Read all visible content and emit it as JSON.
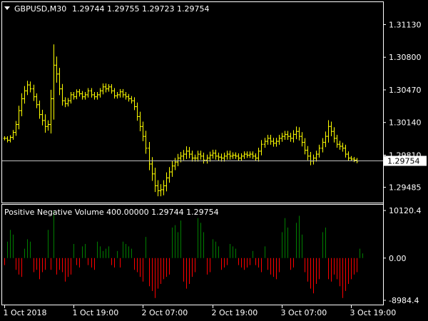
{
  "price_panel": {
    "symbol_label": "GBPUSD,M30",
    "ohlc": [
      "1.29744",
      "1.29755",
      "1.29723",
      "1.29754"
    ],
    "current_price_label": "1.29754",
    "bar_color": "#ffff00",
    "price_line_color": "#c0c0c0"
  },
  "indicator_panel": {
    "title": "Positive Negative Volume 400.00000 1.29744 1.29754",
    "positive_color": "#008000",
    "negative_color": "#ff0000"
  },
  "colors": {
    "background": "#000000",
    "frame": "#ffffff",
    "text": "#ffffff"
  },
  "chart_data": [
    {
      "type": "ohlc",
      "title": "GBPUSD,M30",
      "ylim": [
        1.2933,
        1.3135
      ],
      "y_ticks": [
        "1.31130",
        "1.30800",
        "1.30470",
        "1.30140",
        "1.29810",
        "1.29485"
      ],
      "y_tick_values": [
        1.3113,
        1.308,
        1.3047,
        1.3014,
        1.2981,
        1.29485
      ],
      "x_ticks": [
        "1 Oct 2018",
        "1 Oct 19:00",
        "2 Oct 07:00",
        "2 Oct 19:00",
        "3 Oct 07:00",
        "3 Oct 19:00"
      ],
      "x_tick_bar_index": [
        0,
        24,
        48,
        72,
        96,
        120
      ],
      "close": [
        1.2998,
        1.2996,
        1.2999,
        1.3004,
        1.3012,
        1.3026,
        1.3038,
        1.3046,
        1.3052,
        1.3048,
        1.304,
        1.3032,
        1.3022,
        1.3016,
        1.301,
        1.3012,
        1.3038,
        1.3072,
        1.3063,
        1.3048,
        1.3036,
        1.3033,
        1.3036,
        1.3042,
        1.304,
        1.3045,
        1.3043,
        1.304,
        1.3042,
        1.3046,
        1.3042,
        1.304,
        1.3042,
        1.3046,
        1.305,
        1.3048,
        1.305,
        1.3046,
        1.3041,
        1.3042,
        1.3045,
        1.3042,
        1.304,
        1.3038,
        1.3036,
        1.303,
        1.302,
        1.301,
        1.3,
        1.2988,
        1.2972,
        1.2962,
        1.295,
        1.2945,
        1.2946,
        1.295,
        1.2958,
        1.2964,
        1.297,
        1.2974,
        1.2978,
        1.298,
        1.2982,
        1.2985,
        1.2982,
        1.2978,
        1.2978,
        1.2982,
        1.298,
        1.2976,
        1.2978,
        1.2981,
        1.2983,
        1.298,
        1.2979,
        1.2978,
        1.298,
        1.2982,
        1.298,
        1.2981,
        1.298,
        1.2978,
        1.298,
        1.2982,
        1.2981,
        1.2982,
        1.298,
        1.2978,
        1.2985,
        1.2992,
        1.2995,
        1.2998,
        1.2995,
        1.2993,
        1.2995,
        1.2998,
        1.3,
        1.3002,
        1.3,
        1.2998,
        1.3002,
        1.3005,
        1.3,
        1.2994,
        1.2986,
        1.298,
        1.2975,
        1.2978,
        1.2982,
        1.2988,
        1.2994,
        1.3,
        1.301,
        1.3005,
        1.2998,
        1.2992,
        1.299,
        1.2988,
        1.2982,
        1.2978,
        1.2977,
        1.2976,
        1.2975
      ],
      "range": [
        0.0006,
        0.0006,
        0.0006,
        0.0007,
        0.001,
        0.0014,
        0.0016,
        0.0014,
        0.0012,
        0.001,
        0.0012,
        0.001,
        0.0012,
        0.0014,
        0.0018,
        0.0012,
        0.0026,
        0.006,
        0.0025,
        0.0018,
        0.0014,
        0.001,
        0.0008,
        0.0008,
        0.0008,
        0.0007,
        0.0008,
        0.0008,
        0.0008,
        0.0008,
        0.0008,
        0.0008,
        0.0008,
        0.0008,
        0.001,
        0.001,
        0.0008,
        0.0008,
        0.0008,
        0.0008,
        0.0008,
        0.0008,
        0.0008,
        0.0008,
        0.0008,
        0.001,
        0.0012,
        0.0014,
        0.0014,
        0.0016,
        0.0018,
        0.002,
        0.0018,
        0.0016,
        0.0016,
        0.0016,
        0.0016,
        0.0014,
        0.0014,
        0.0012,
        0.0012,
        0.0012,
        0.0012,
        0.0014,
        0.0012,
        0.001,
        0.001,
        0.001,
        0.001,
        0.001,
        0.001,
        0.001,
        0.001,
        0.001,
        0.001,
        0.001,
        0.001,
        0.001,
        0.001,
        0.0008,
        0.0008,
        0.0008,
        0.0008,
        0.0008,
        0.0008,
        0.0008,
        0.0008,
        0.0008,
        0.001,
        0.0012,
        0.001,
        0.001,
        0.001,
        0.001,
        0.001,
        0.001,
        0.001,
        0.001,
        0.001,
        0.001,
        0.0012,
        0.0014,
        0.0012,
        0.0012,
        0.0012,
        0.0012,
        0.0012,
        0.001,
        0.001,
        0.001,
        0.0012,
        0.0014,
        0.0018,
        0.0014,
        0.0012,
        0.001,
        0.001,
        0.001,
        0.001,
        0.0008,
        0.0006,
        0.0006,
        0.0006
      ]
    },
    {
      "type": "bar",
      "title": "Positive Negative Volume 400.00000 1.29744 1.29754",
      "ylim": [
        -9900,
        11200
      ],
      "y_ticks": [
        "10120.4",
        "0.00",
        "-8984.4"
      ],
      "y_tick_values": [
        10120.4,
        0,
        -8984.4
      ],
      "values": [
        -1500,
        3500,
        6000,
        5000,
        -2500,
        -3500,
        -4000,
        2000,
        4000,
        3500,
        -3000,
        -2500,
        -4500,
        -3000,
        -2500,
        6000,
        -2500,
        10100,
        -3500,
        -2500,
        -3000,
        -5000,
        -4000,
        -3500,
        3000,
        -1500,
        -2000,
        2500,
        3000,
        -1500,
        -2000,
        -2500,
        3500,
        2500,
        1500,
        2000,
        2500,
        -1500,
        -2000,
        1500,
        -2000,
        3500,
        3000,
        2500,
        2000,
        -2500,
        -3000,
        -4000,
        -5000,
        4500,
        -6000,
        -7000,
        -8500,
        -6500,
        -5500,
        -4500,
        -4000,
        -3500,
        6500,
        7000,
        5500,
        8000,
        -5000,
        -6500,
        -5500,
        -4000,
        -3000,
        8500,
        7500,
        5500,
        -3500,
        -3000,
        4000,
        3500,
        2500,
        -2500,
        -2000,
        -1500,
        3000,
        2500,
        2000,
        -1500,
        -2000,
        -2500,
        -2000,
        -1500,
        1500,
        -1500,
        -2000,
        -3000,
        2500,
        -2500,
        -3500,
        -4000,
        -4500,
        -3000,
        5500,
        8500,
        6500,
        -2500,
        -2000,
        7500,
        9000,
        5000,
        -3000,
        -5000,
        -6500,
        -7500,
        -5500,
        -4500,
        5500,
        6500,
        -4500,
        -5000,
        -3500,
        -4500,
        -6000,
        -8500,
        -7000,
        -5500,
        -4500,
        -3500,
        -3000,
        2000,
        1000
      ]
    }
  ]
}
